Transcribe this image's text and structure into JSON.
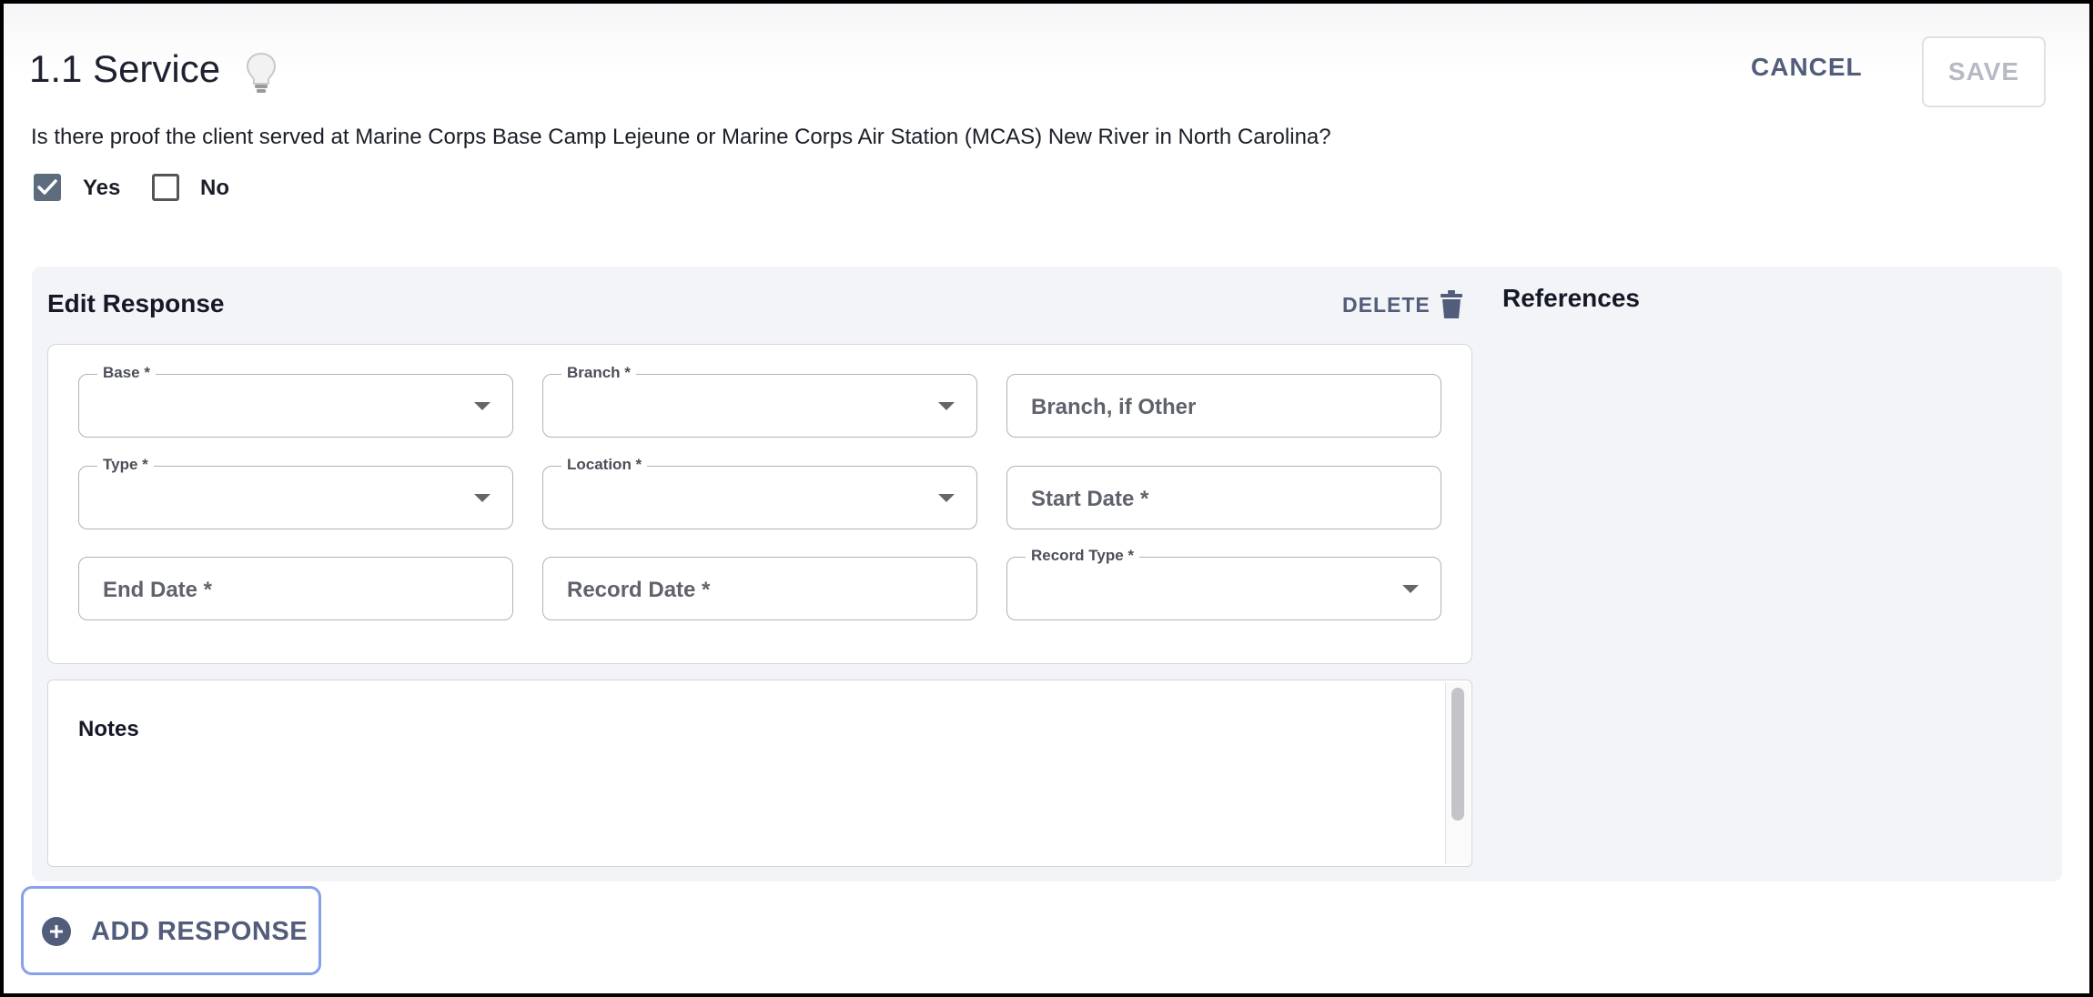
{
  "header": {
    "title": "1.1 Service",
    "cancel_label": "CANCEL",
    "save_label": "SAVE"
  },
  "question": {
    "text": "Is there proof the client served at Marine Corps Base Camp Lejeune or Marine Corps Air Station (MCAS) New River in North Carolina?",
    "options": [
      {
        "label": "Yes",
        "checked": true
      },
      {
        "label": "No",
        "checked": false
      }
    ]
  },
  "edit_response": {
    "title": "Edit Response",
    "delete_label": "DELETE",
    "fields": {
      "base": {
        "label": "Base *",
        "value": ""
      },
      "branch": {
        "label": "Branch *",
        "value": ""
      },
      "branch_other": {
        "placeholder": "Branch, if Other"
      },
      "type": {
        "label": "Type *",
        "value": ""
      },
      "location": {
        "label": "Location *",
        "value": ""
      },
      "start_date": {
        "placeholder": "Start Date *"
      },
      "end_date": {
        "placeholder": "End Date *"
      },
      "record_date": {
        "placeholder": "Record Date *"
      },
      "record_type": {
        "label": "Record Type *",
        "value": ""
      }
    },
    "notes_label": "Notes"
  },
  "references": {
    "title": "References"
  },
  "add_response_label": "ADD RESPONSE",
  "colors": {
    "accent": "#525d7b",
    "checkbox_checked": "#5c6c7d",
    "focus_ring": "#86a0ea",
    "panel_bg": "#f3f4f8"
  }
}
